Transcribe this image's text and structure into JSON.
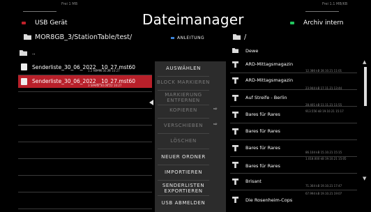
{
  "header": {
    "title": "Dateimanager",
    "left_free": "Frei 1 MB",
    "right_free": "Frei 1.1 MB/KB",
    "left_device": {
      "label": "USB Gerät",
      "color": "#c0202a"
    },
    "right_device": {
      "label": "Archiv intern",
      "color": "#22c55e"
    }
  },
  "pathbar": {
    "left_path": "MOR8GB_3/StationTable/test/",
    "help_label": "Anleitung",
    "help_color": "#3b82d8",
    "right_path": "/"
  },
  "left_list": {
    "items": [
      {
        "kind": "parent-folder",
        "name": ".."
      },
      {
        "kind": "file",
        "name": "Senderliste_30_06_2022__10_27.mst60",
        "meta": "1.2 MB  30.06.22 10:27",
        "selected": false
      },
      {
        "kind": "file",
        "name": "Senderliste_30_06_2022__10_27.mst60",
        "meta": "3 SPARE  30.06.22 10:27",
        "selected": true
      }
    ]
  },
  "menu": {
    "items": [
      {
        "label": "Auswählen",
        "enabled": true,
        "arrow": false
      },
      {
        "label": "Block markieren",
        "enabled": false,
        "arrow": false
      },
      {
        "label": "Markierung entfernen",
        "enabled": false,
        "arrow": false
      },
      {
        "label": "Kopieren",
        "enabled": false,
        "arrow": true
      },
      {
        "label": "Verschieben",
        "enabled": false,
        "arrow": true
      },
      {
        "label": "Löschen",
        "enabled": false,
        "arrow": false
      },
      {
        "label": "Neuer Ordner",
        "enabled": true,
        "arrow": false
      },
      {
        "label": "Importieren",
        "enabled": true,
        "arrow": false
      },
      {
        "label": "Senderlisten exportieren",
        "enabled": true,
        "arrow": false
      },
      {
        "label": "USB abmelden",
        "enabled": true,
        "arrow": false
      }
    ],
    "arrow_glyph": "⇨"
  },
  "right_list": {
    "items": [
      {
        "kind": "folder",
        "name": "Dewe",
        "meta": ""
      },
      {
        "kind": "video",
        "name": "ARD-Mittagsmagazin",
        "meta": "12.386 kB  28.10.21 11:01"
      },
      {
        "kind": "video",
        "name": "ARD-Mittagsmagazin",
        "meta": "23.944 kB  17.11.21 13:44"
      },
      {
        "kind": "video",
        "name": "Auf Streife - Berlin",
        "meta": "28.401 kB  11.11.21 11:55"
      },
      {
        "kind": "video",
        "name": "Bares für Rares",
        "meta": "913.556 kB  19.10.21 15:17"
      },
      {
        "kind": "video",
        "name": "Bares für Rares",
        "meta": ""
      },
      {
        "kind": "video",
        "name": "Bares für Rares",
        "meta": "86.104 kB  15.10.21 15:15"
      },
      {
        "kind": "video",
        "name": "Bares für Rares",
        "meta": "1.018.000 kB  19.10.21 15:05"
      },
      {
        "kind": "video",
        "name": "Brisant",
        "meta": "71.364 kB  19.10.21 17:47"
      },
      {
        "kind": "video",
        "name": "Die Rosenheim-Cops",
        "meta": "67.994 kB  19.10.21 19:07"
      }
    ]
  }
}
